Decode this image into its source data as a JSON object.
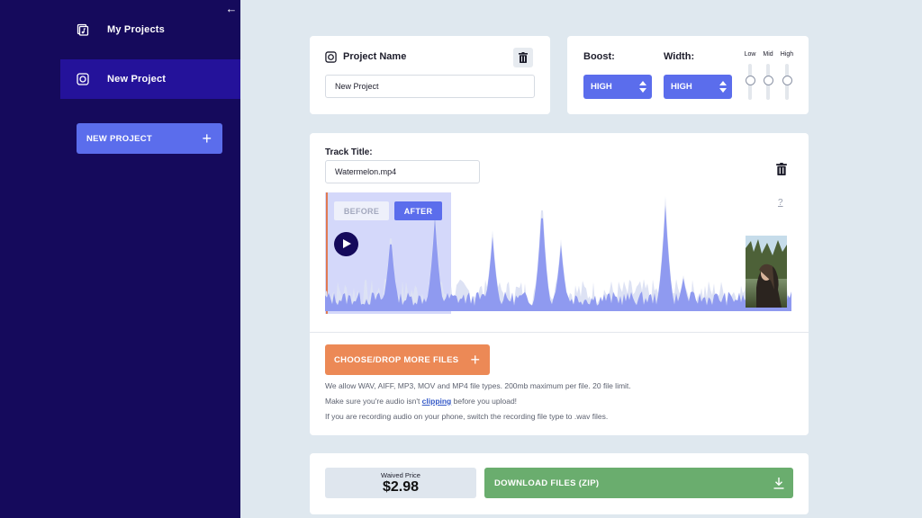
{
  "sidebar": {
    "collapse_icon": "arrow-left-icon",
    "items": [
      {
        "label": "My Projects",
        "icon": "folder-music-icon",
        "active": false
      },
      {
        "label": "New Project",
        "icon": "project-icon",
        "active": true
      }
    ],
    "new_project_button": "NEW PROJECT",
    "new_project_icon": "plus-icon"
  },
  "project": {
    "title": "Project Name",
    "name_value": "New Project",
    "delete_icon": "trash-icon"
  },
  "settings": {
    "boost_label": "Boost:",
    "boost_value": "HIGH",
    "width_label": "Width:",
    "width_value": "HIGH",
    "eq": [
      {
        "label": "Low",
        "level": 0.5
      },
      {
        "label": "Mid",
        "level": 0.5
      },
      {
        "label": "High",
        "level": 0.5
      }
    ]
  },
  "track": {
    "title_label": "Track Title:",
    "title_value": "Watermelon.mp4",
    "before_label": "BEFORE",
    "after_label": "AFTER",
    "help_label": "?",
    "choose_button": "CHOOSE/DROP MORE FILES",
    "info_line1": "We allow WAV, AIFF, MP3, MOV and MP4 file types. 200mb maximum per file. 20 file limit.",
    "info_line2_before": "Make sure you're audio isn't ",
    "info_line2_link": "clipping",
    "info_line2_after": " before you upload!",
    "info_line3": "If you are recording audio on your phone, switch the recording file type to .wav files."
  },
  "price": {
    "label": "Waived Price",
    "value": "$2.98",
    "download_button": "DOWNLOAD FILES (ZIP)",
    "download_icon": "download-icon"
  },
  "colors": {
    "sidebar_bg": "#150a5c",
    "accent": "#5b6dec",
    "orange": "#ec8956",
    "green": "#6aad6e"
  }
}
